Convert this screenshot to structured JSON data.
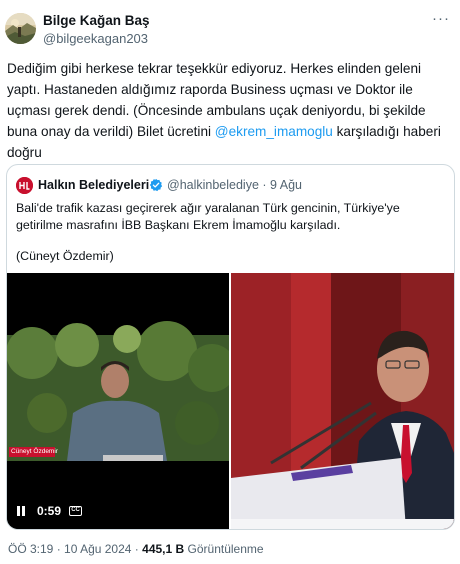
{
  "author": {
    "name": "Bilge Kağan Baş",
    "handle": "@bilgeekagan203"
  },
  "tweet": {
    "text_before_mention": "Dediğim gibi herkese tekrar teşekkür ediyoruz. Herkes elinden geleni yaptı. Hastaneden aldığımız raporda Business uçması ve Doktor ile uçması gerek dendi. (Öncesinde ambulans uçak deniyordu, bi şekilde buna onay da verildi) Bilet ücretini ",
    "mention": "@ekrem_imamoglu",
    "text_after_mention": " karşıladığı haberi doğru"
  },
  "quoted": {
    "name": "Halkın Belediyeleri",
    "handle_and_date": "@halkinbelediye · 9 Ağu",
    "text": "Bali'de trafik kazası geçirerek ağır yaralanan Türk gencinin, Türkiye'ye getirilme masrafını İBB Başkanı Ekrem İmamoğlu karşıladı.",
    "credit": "(Cüneyt Özdemir)",
    "video": {
      "duration": "0:59",
      "caption_badge": "Cüneyt Özdemir",
      "cc_label": "CC"
    }
  },
  "meta": {
    "time": "ÖÖ 3:19",
    "separator": "·",
    "date": "10 Ağu 2024",
    "views": "445,1 B",
    "views_label": "Görüntülenme"
  },
  "icons": {
    "more": "more-horizontal-icon",
    "verified": "verified-badge-icon",
    "pause": "pause-icon",
    "captions": "captions-icon"
  },
  "colors": {
    "link": "#1d9bf0",
    "secondary_text": "#536471",
    "verified": "#1d9bf0",
    "quote_border": "#cfd9de"
  }
}
